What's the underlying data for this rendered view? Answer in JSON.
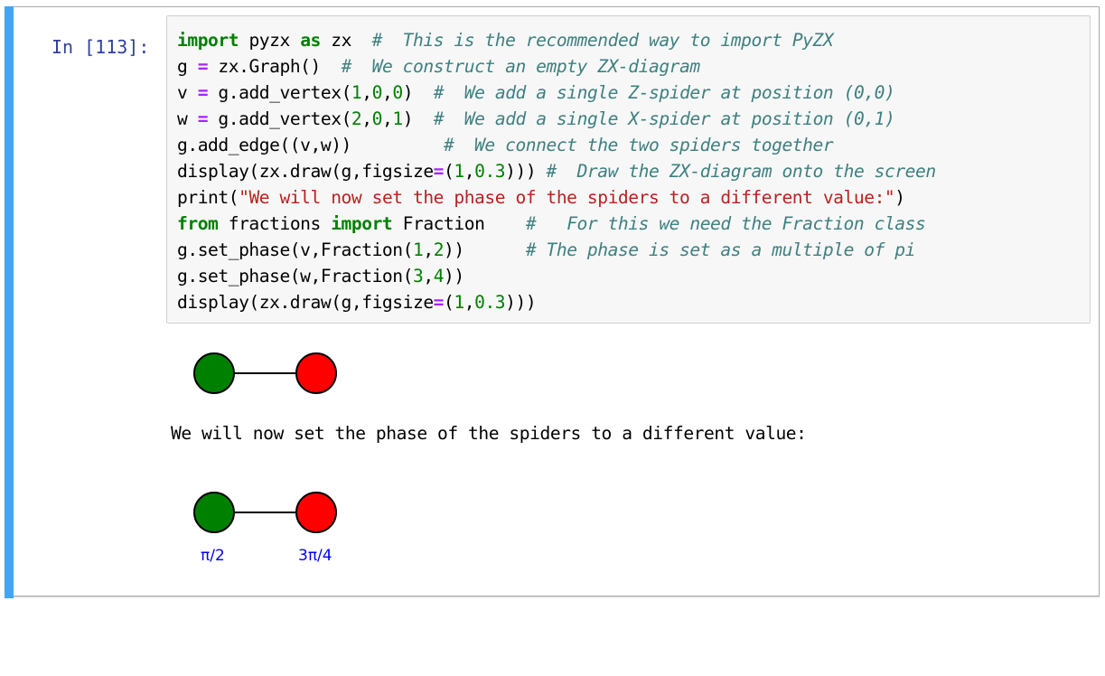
{
  "cell": {
    "prompt": "In [113]:",
    "accent_color": "#42a5f5"
  },
  "code": {
    "lines": [
      [
        {
          "t": "import",
          "c": "kw"
        },
        {
          "t": " pyzx "
        },
        {
          "t": "as",
          "c": "kw"
        },
        {
          "t": " zx  "
        },
        {
          "t": "#  This is the recommended way to import PyZX",
          "c": "cm"
        }
      ],
      [
        {
          "t": "g "
        },
        {
          "t": "=",
          "c": "op"
        },
        {
          "t": " zx.Graph()  "
        },
        {
          "t": "#  We construct an empty ZX-diagram",
          "c": "cm"
        }
      ],
      [
        {
          "t": "v "
        },
        {
          "t": "=",
          "c": "op"
        },
        {
          "t": " g.add_vertex("
        },
        {
          "t": "1",
          "c": "num"
        },
        {
          "t": ","
        },
        {
          "t": "0",
          "c": "num"
        },
        {
          "t": ","
        },
        {
          "t": "0",
          "c": "num"
        },
        {
          "t": ")  "
        },
        {
          "t": "#  We add a single Z-spider at position (0,0)",
          "c": "cm"
        }
      ],
      [
        {
          "t": "w "
        },
        {
          "t": "=",
          "c": "op"
        },
        {
          "t": " g.add_vertex("
        },
        {
          "t": "2",
          "c": "num"
        },
        {
          "t": ","
        },
        {
          "t": "0",
          "c": "num"
        },
        {
          "t": ","
        },
        {
          "t": "1",
          "c": "num"
        },
        {
          "t": ")  "
        },
        {
          "t": "#  We add a single X-spider at position (0,1)",
          "c": "cm"
        }
      ],
      [
        {
          "t": "g.add_edge((v,w))         "
        },
        {
          "t": "#  We connect the two spiders together",
          "c": "cm"
        }
      ],
      [
        {
          "t": "display(zx.draw(g,figsize"
        },
        {
          "t": "=",
          "c": "op"
        },
        {
          "t": "("
        },
        {
          "t": "1",
          "c": "num"
        },
        {
          "t": ","
        },
        {
          "t": "0.3",
          "c": "num"
        },
        {
          "t": "))) "
        },
        {
          "t": "#  Draw the ZX-diagram onto the screen",
          "c": "cm"
        }
      ],
      [
        {
          "t": "print("
        },
        {
          "t": "\"We will now set the phase of the spiders to a different value:\"",
          "c": "str"
        },
        {
          "t": ")"
        }
      ],
      [
        {
          "t": "from",
          "c": "kw"
        },
        {
          "t": " fractions "
        },
        {
          "t": "import",
          "c": "kw"
        },
        {
          "t": " Fraction    "
        },
        {
          "t": "#   For this we need the Fraction class",
          "c": "cm"
        }
      ],
      [
        {
          "t": "g.set_phase(v,Fraction("
        },
        {
          "t": "1",
          "c": "num"
        },
        {
          "t": ","
        },
        {
          "t": "2",
          "c": "num"
        },
        {
          "t": "))      "
        },
        {
          "t": "# The phase is set as a multiple of pi",
          "c": "cm"
        }
      ],
      [
        {
          "t": "g.set_phase(w,Fraction("
        },
        {
          "t": "3",
          "c": "num"
        },
        {
          "t": ","
        },
        {
          "t": "4",
          "c": "num"
        },
        {
          "t": "))"
        }
      ],
      [
        {
          "t": "display(zx.draw(g,figsize"
        },
        {
          "t": "=",
          "c": "op"
        },
        {
          "t": "("
        },
        {
          "t": "1",
          "c": "num"
        },
        {
          "t": ","
        },
        {
          "t": "0.3",
          "c": "num"
        },
        {
          "t": "))"
        },
        {
          "t": ")"
        }
      ]
    ]
  },
  "outputs": {
    "diagram1": {
      "spiders": [
        {
          "type": "Z",
          "color": "#008000",
          "phase": ""
        },
        {
          "type": "X",
          "color": "#ff0000",
          "phase": ""
        }
      ]
    },
    "print_text": "We will now set the phase of the spiders to a different value:",
    "diagram2": {
      "spiders": [
        {
          "type": "Z",
          "color": "#008000",
          "phase": "π/2"
        },
        {
          "type": "X",
          "color": "#ff0000",
          "phase": "3π/4"
        }
      ],
      "phase_color": "#0000ff"
    }
  }
}
